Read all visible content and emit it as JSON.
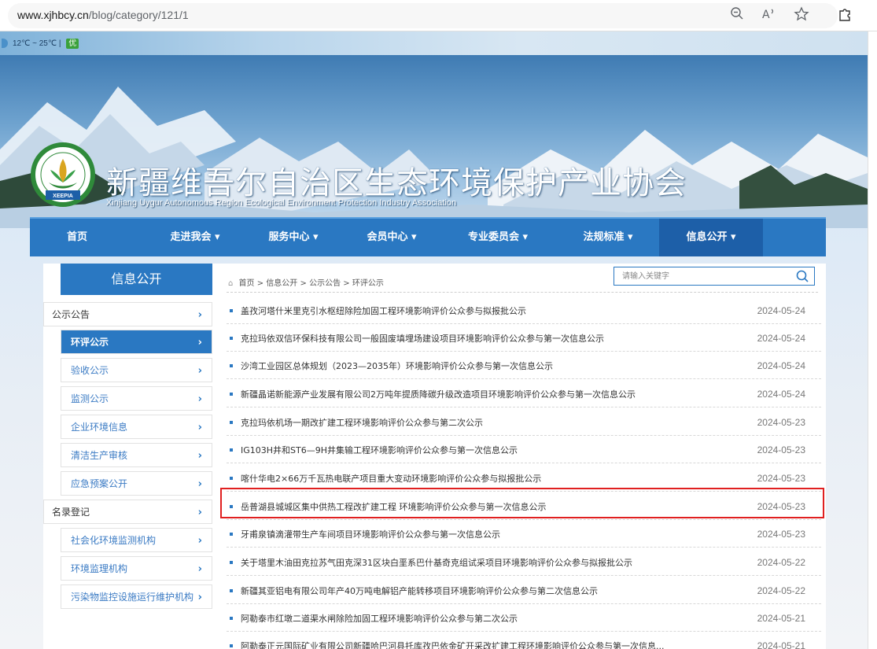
{
  "browser": {
    "url_host": "www.xjhbcy.cn",
    "url_path": "/blog/category/121/1",
    "icons": [
      "zoom-out-icon",
      "read-aloud-icon",
      "favorite-star-icon",
      "extensions-icon"
    ]
  },
  "weather": {
    "temp": "12℃ ~ 25℃ |",
    "aqi": "优"
  },
  "header": {
    "title": "新疆维吾尔自治区生态环境保护产业协会",
    "subtitle": "Xinjiang Uygur Autonomous Region Ecological Environment Protection Industry Association",
    "logo_text": "XEEPIA"
  },
  "nav": {
    "items": [
      {
        "label": "首页"
      },
      {
        "label": "走进我会 ▾"
      },
      {
        "label": "服务中心 ▾"
      },
      {
        "label": "会员中心 ▾"
      },
      {
        "label": "专业委员会 ▾"
      },
      {
        "label": "法规标准 ▾"
      },
      {
        "label": "信息公开 ▾"
      }
    ]
  },
  "sidebar": {
    "title": "信息公开",
    "items": [
      {
        "label": "公示公告",
        "level": "cat"
      },
      {
        "label": "环评公示",
        "level": "sub",
        "active": true
      },
      {
        "label": "验收公示",
        "level": "sub"
      },
      {
        "label": "监测公示",
        "level": "sub"
      },
      {
        "label": "企业环境信息",
        "level": "sub"
      },
      {
        "label": "清洁生产审核",
        "level": "sub"
      },
      {
        "label": "应急预案公开",
        "level": "sub"
      },
      {
        "label": "名录登记",
        "level": "cat"
      },
      {
        "label": "社会化环境监测机构",
        "level": "sub"
      },
      {
        "label": "环境监理机构",
        "level": "sub"
      },
      {
        "label": "污染物监控设施运行维护机构",
        "level": "sub"
      }
    ]
  },
  "breadcrumb": {
    "home": "首页",
    "sep": ">",
    "level1": "信息公开",
    "level2": "公示公告",
    "level3": "环评公示"
  },
  "search": {
    "placeholder": "请输入关键字"
  },
  "list": [
    {
      "title": "盖孜河塔什米里克引水枢纽除险加固工程环境影响评价公众参与拟报批公示",
      "date": "2024-05-24"
    },
    {
      "title": "克拉玛依双信环保科技有限公司一般固废填埋场建设项目环境影响评价公众参与第一次信息公示",
      "date": "2024-05-24"
    },
    {
      "title": "沙湾工业园区总体规划（2023—2035年）环境影响评价公众参与第一次信息公示",
      "date": "2024-05-24"
    },
    {
      "title": "新疆晶诺新能源产业发展有限公司2万吨年提质降碳升级改造项目环境影响评价公众参与第一次信息公示",
      "date": "2024-05-24"
    },
    {
      "title": "克拉玛依机场一期改扩建工程环境影响评价公众参与第二次公示",
      "date": "2024-05-23"
    },
    {
      "title": "IG103H井和ST6—9H井集输工程环境影响评价公众参与第一次信息公示",
      "date": "2024-05-23"
    },
    {
      "title": "喀什华电2×66万千瓦热电联产项目重大变动环境影响评价公众参与拟报批公示",
      "date": "2024-05-23"
    },
    {
      "title": "岳普湖县城城区集中供热工程改扩建工程 环境影响评价公众参与第一次信息公示",
      "date": "2024-05-23"
    },
    {
      "title": "牙甫泉镇滴灌带生产车间项目环境影响评价公众参与第一次信息公示",
      "date": "2024-05-23"
    },
    {
      "title": "关于塔里木油田克拉苏气田克深31区块白垩系巴什基奇克组试采项目环境影响评价公众参与拟报批公示",
      "date": "2024-05-22"
    },
    {
      "title": "新疆其亚铝电有限公司年产40万吨电解铝产能转移项目环境影响评价公众参与第二次信息公示",
      "date": "2024-05-22"
    },
    {
      "title": "阿勒泰市红墩二道渠水闸除险加固工程环境影响评价公众参与第二次公示",
      "date": "2024-05-21"
    },
    {
      "title": "阿勒泰正元国际矿业有限公司新疆哈巴河县托库孜巴依金矿开采改扩建工程环境影响评价公众参与第一次信息...",
      "date": "2024-05-21"
    }
  ],
  "colors": {
    "brand_blue": "#2a78c2",
    "highlight_red": "#e02020"
  }
}
